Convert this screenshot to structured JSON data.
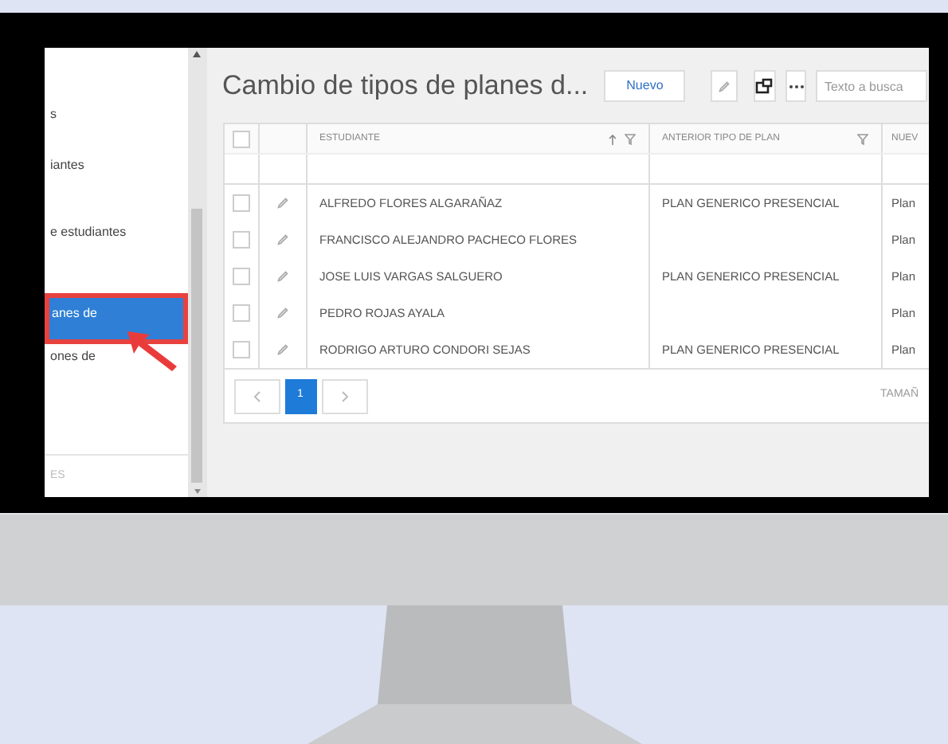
{
  "sidebar": {
    "items": [
      {
        "label": "s",
        "selected": false
      },
      {
        "label": "iantes",
        "selected": false
      },
      {
        "label": "e estudiantes",
        "selected": false
      },
      {
        "label": "anes de",
        "selected": true
      },
      {
        "label": "ones de",
        "selected": false
      }
    ],
    "footer": "ES"
  },
  "header": {
    "title": "Cambio de tipos de planes d...",
    "new_button": "Nuevo",
    "search": {
      "placeholder": "Texto a busca"
    }
  },
  "table": {
    "select_all_checked": false,
    "columns": [
      "ESTUDIANTE",
      "ANTERIOR TIPO DE PLAN",
      "NUEV"
    ],
    "rows": [
      {
        "estudiante": "ALFREDO FLORES ALGARAÑAZ",
        "anterior": "PLAN GENERICO PRESENCIAL",
        "nuevo": "Plan",
        "checked": false
      },
      {
        "estudiante": "FRANCISCO ALEJANDRO PACHECO FLORES",
        "nuevo": "Plan",
        "checked": false
      },
      {
        "estudiante": "JOSE LUIS VARGAS SALGUERO",
        "anterior": "PLAN GENERICO PRESENCIAL",
        "nuevo": "Plan",
        "checked": false
      },
      {
        "estudiante": "PEDRO ROJAS AYALA",
        "nuevo": "Plan",
        "checked": false
      },
      {
        "estudiante": "RODRIGO ARTURO CONDORI SEJAS",
        "anterior": "PLAN GENERICO PRESENCIAL",
        "nuevo": "Plan",
        "checked": false
      }
    ]
  },
  "pagination": {
    "pages": [
      {
        "label": "1",
        "selected": true
      }
    ],
    "page_size_label": "TAMAÑ"
  }
}
